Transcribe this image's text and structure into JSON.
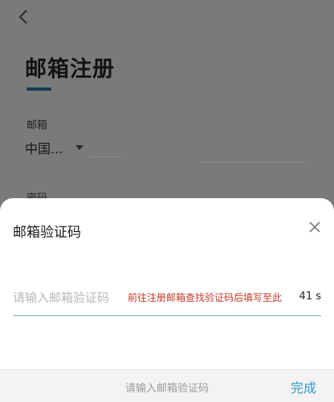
{
  "background_page": {
    "title": "邮箱注册",
    "email_label": "邮箱",
    "country_value": "中国...",
    "password_label_partial": "密码"
  },
  "sheet": {
    "title": "邮箱验证码",
    "code_placeholder": "请输入邮箱验证码",
    "hint": "前往注册邮箱查找验证码后填写至此",
    "countdown": "41 s"
  },
  "accessory_bar": {
    "placeholder": "请输入邮箱验证码",
    "done_label": "完成"
  },
  "colors": {
    "accent": "#2f9ac8",
    "hint_red": "#c0392b",
    "title_underline": "#123e52"
  },
  "icons": {
    "back": "back-arrow-icon",
    "close": "close-icon",
    "dropdown": "caret-down-icon"
  }
}
